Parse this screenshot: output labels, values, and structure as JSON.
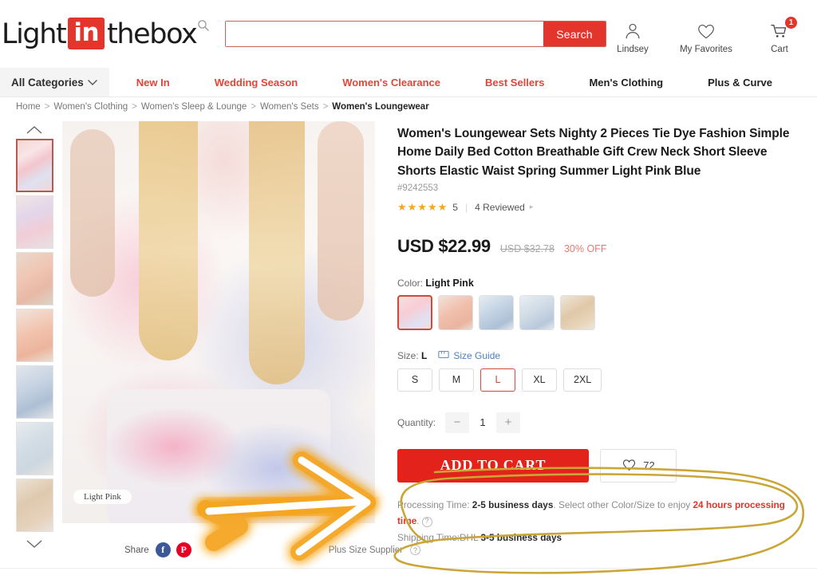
{
  "header": {
    "logo": {
      "part1": "Light",
      "part2": "in",
      "part3": "thebox"
    },
    "search": {
      "placeholder": "",
      "value": "",
      "button_label": "Search",
      "icon": "search-icon"
    },
    "account": {
      "icon": "user-icon",
      "label": "Lindsey"
    },
    "favorites": {
      "icon": "heart-icon",
      "label": "My Favorites"
    },
    "cart": {
      "icon": "cart-icon",
      "label": "Cart",
      "badge": "1"
    }
  },
  "nav": {
    "all_categories": "All Categories",
    "chevron_icon": "chevron-down-icon",
    "items": [
      {
        "label": "New In",
        "style": "red"
      },
      {
        "label": "Wedding Season",
        "style": "red"
      },
      {
        "label": "Women's Clearance",
        "style": "red"
      },
      {
        "label": "Best Sellers",
        "style": "red"
      },
      {
        "label": "Men's Clothing",
        "style": "dark"
      },
      {
        "label": "Plus & Curve",
        "style": "dark"
      }
    ]
  },
  "breadcrumb": [
    {
      "label": "Home"
    },
    {
      "label": "Women's Clothing"
    },
    {
      "label": "Women's Sleep & Lounge"
    },
    {
      "label": "Women's Sets"
    },
    {
      "label": "Women's Loungewear"
    }
  ],
  "gallery": {
    "up_icon": "chevron-up-icon",
    "down_icon": "chevron-down-icon",
    "thumb_count": 7,
    "selected_index": 0,
    "main_color_badge": "Light Pink"
  },
  "share": {
    "label": "Share",
    "facebook_icon": "facebook-icon",
    "pinterest_icon": "pinterest-icon",
    "supplier_label": "Plus Size Supplier",
    "supplier_help_icon": "question-circle-icon"
  },
  "product": {
    "title": "Women's Loungewear Sets Nighty 2 Pieces Tie Dye Fashion Simple Home Daily Bed Cotton Breathable Gift Crew Neck Short Sleeve Shorts Elastic Waist Spring Summer Light Pink Blue",
    "sku": "#9242553",
    "rating_stars": "★★★★★",
    "rating_value": "5",
    "reviews_label": "4 Reviewed",
    "review_caret_icon": "chevron-right-icon",
    "price_now": "USD $22.99",
    "price_old": "USD $32.78",
    "discount": "30% OFF",
    "color_label": "Color:",
    "color_value": "Light Pink",
    "colors": [
      {
        "name": "Light Pink",
        "selected": true
      },
      {
        "name": "Pink",
        "selected": false
      },
      {
        "name": "Blue",
        "selected": false
      },
      {
        "name": "Light Blue",
        "selected": false
      },
      {
        "name": "Beige",
        "selected": false
      }
    ],
    "size_label": "Size:",
    "size_value": "L",
    "size_guide": "Size Guide",
    "size_guide_icon": "ruler-icon",
    "sizes": [
      {
        "label": "S",
        "selected": false
      },
      {
        "label": "M",
        "selected": false
      },
      {
        "label": "L",
        "selected": true
      },
      {
        "label": "XL",
        "selected": false
      },
      {
        "label": "2XL",
        "selected": false
      }
    ],
    "quantity_label": "Quantity:",
    "quantity_value": "1",
    "qty_minus": "−",
    "qty_plus": "+",
    "add_to_cart": "ADD TO CART",
    "favorite_icon": "heart-outline-icon",
    "favorite_count": "72"
  },
  "shipping": {
    "processing_prefix": "Processing Time:",
    "processing_value": "2-5 business days",
    "processing_mid": ". Select other Color/Size to enjoy",
    "processing_highlight": "24 hours processing time",
    "processing_suffix": ".",
    "help_icon": "question-circle-icon",
    "shipping_prefix": "Shipping Time:DHL",
    "shipping_value": "3-5 business days"
  },
  "annotations": {
    "arrow": {
      "name": "highlight-arrow",
      "stroke": "#ffffff",
      "glow": "#f5a623"
    },
    "circle": {
      "name": "highlight-circle",
      "stroke": "#c9a636"
    }
  },
  "colors": {
    "brand_red": "#e3352b",
    "accent_red": "#e3231b",
    "nav_red": "#e1453b",
    "star_gold": "#f5a623",
    "annotation_gold": "#c9a636"
  }
}
